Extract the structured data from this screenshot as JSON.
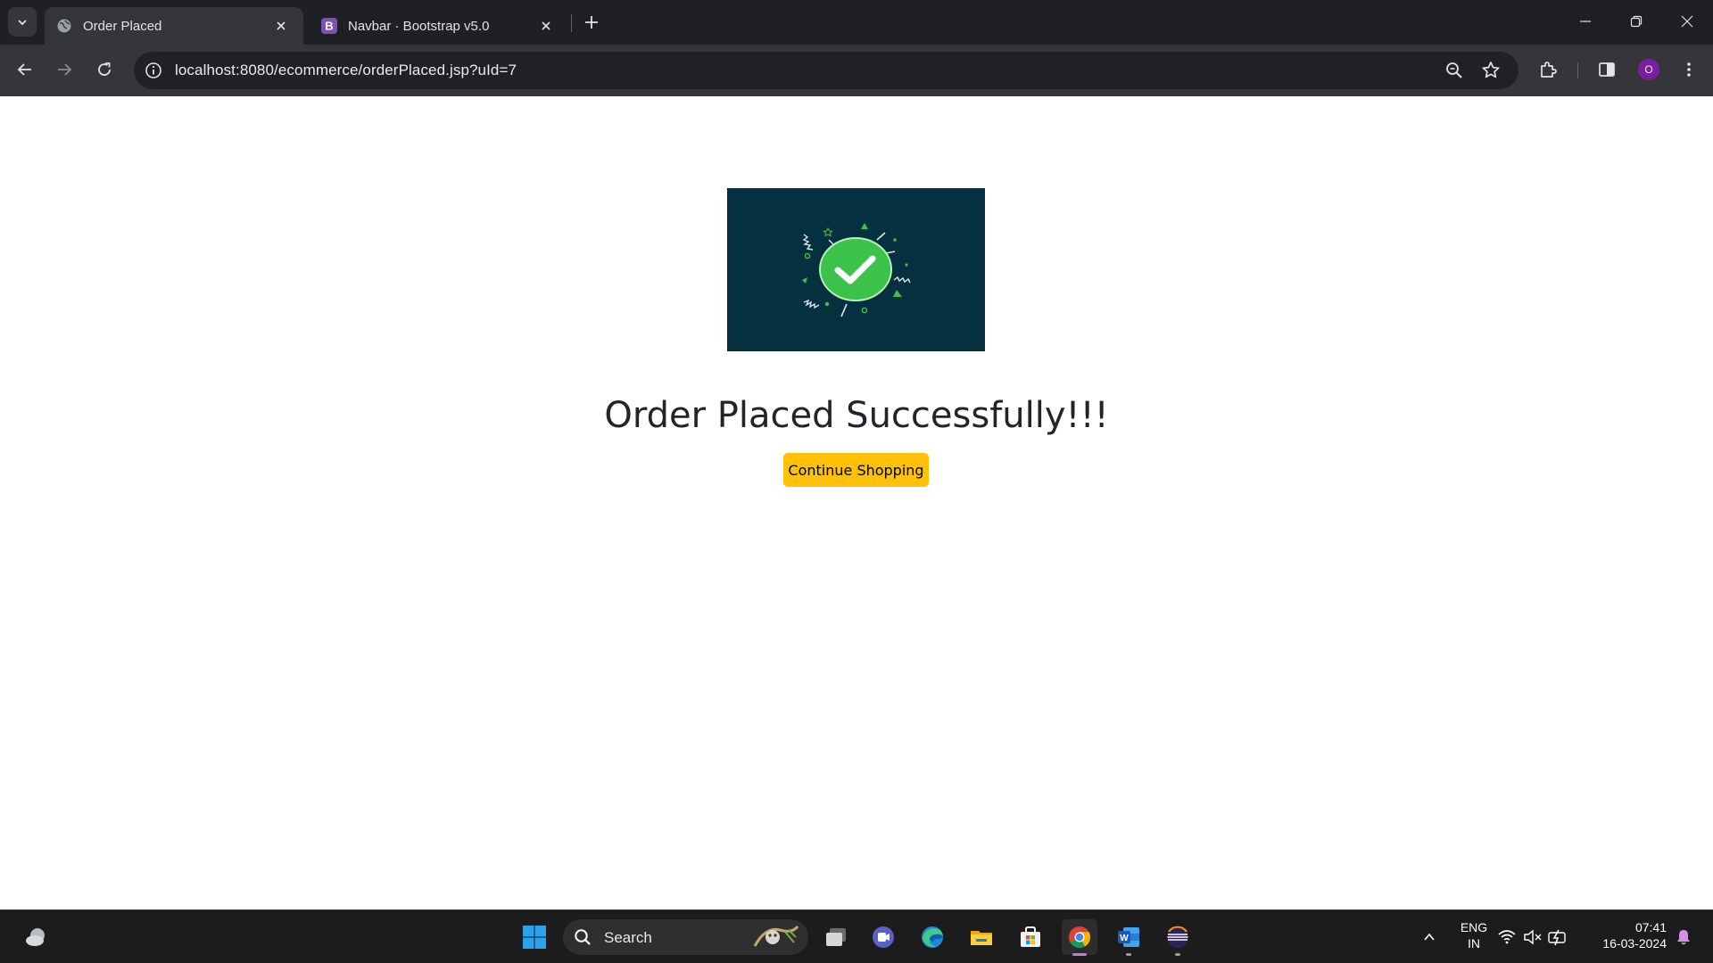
{
  "browser": {
    "tabs": [
      {
        "title": "Order Placed",
        "favicon": "globe-icon",
        "active": true
      },
      {
        "title": "Navbar · Bootstrap v5.0",
        "favicon": "bootstrap-logo",
        "active": false
      }
    ],
    "url": "localhost:8080/ecommerce/orderPlaced.jsp?uId=7",
    "profile_initial": "O",
    "colors": {
      "tabbar": "#1f2023",
      "toolbar": "#35363a",
      "omnibox": "#202124",
      "bootstrap_purple": "#7952b3",
      "profile": "#7b1fa2"
    }
  },
  "page": {
    "heading": "Order Placed Successfully!!!",
    "continue_label": "Continue Shopping",
    "hero_image": "order-success-checkmark-illustration",
    "colors": {
      "hero_bg": "#04303f",
      "check_green": "#3cc24a",
      "button": "#ffc107",
      "heading": "#212529"
    }
  },
  "taskbar": {
    "search_placeholder": "Search",
    "apps": [
      "widgets-icon",
      "start-icon",
      "task-view-icon",
      "teams-icon",
      "edge-icon",
      "file-explorer-icon",
      "store-icon",
      "chrome-icon",
      "word-icon",
      "eclipse-icon"
    ],
    "tray": {
      "language": "ENG",
      "region": "IN",
      "time": "07:41",
      "date": "16-03-2024"
    }
  }
}
